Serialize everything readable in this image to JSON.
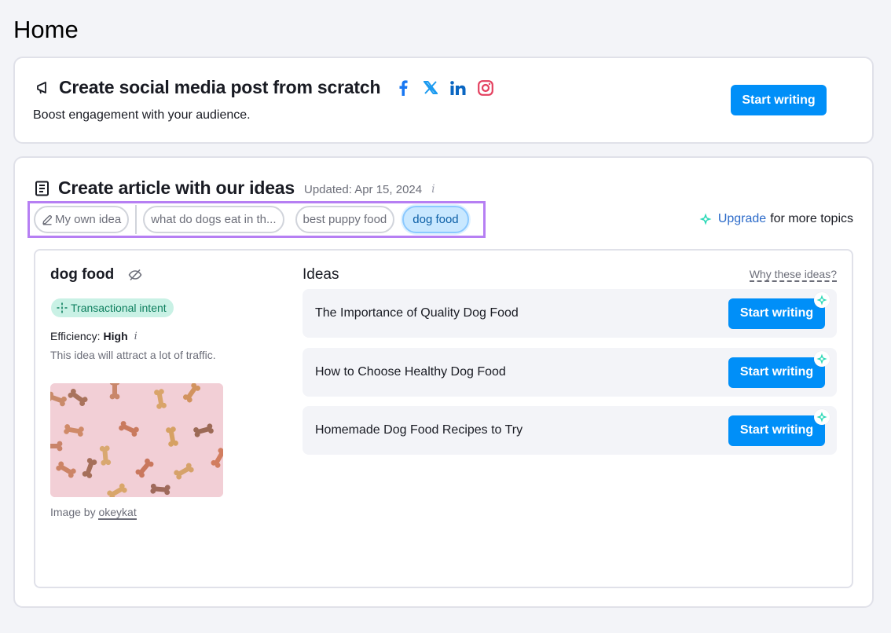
{
  "page": {
    "title": "Home"
  },
  "social_card": {
    "title": "Create social media post from scratch",
    "subtitle": "Boost engagement with your audience.",
    "networks": [
      {
        "name": "Facebook",
        "icon": "facebook-icon",
        "color": "#1877f2"
      },
      {
        "name": "X",
        "icon": "x-icon",
        "color": "#1d9bf0"
      },
      {
        "name": "LinkedIn",
        "icon": "linkedin-icon",
        "color": "#0a66c2"
      },
      {
        "name": "Instagram",
        "icon": "instagram-icon",
        "color": "#e4405f"
      }
    ],
    "start_button": "Start writing"
  },
  "article_card": {
    "title": "Create article with our ideas",
    "updated": "Updated: Apr 15, 2024",
    "topics": [
      {
        "label": "My own idea",
        "icon": "pencil-icon",
        "active": false
      },
      {
        "label": "what do dogs eat in th...",
        "active": false
      },
      {
        "label": "best puppy food",
        "active": false
      },
      {
        "label": "dog food",
        "active": true
      }
    ],
    "upgrade": {
      "link": "Upgrade",
      "text": "for more topics"
    },
    "topic_detail": {
      "title": "dog food",
      "intent": "Transactional intent",
      "efficiency_label": "Efficiency:",
      "efficiency_value": "High",
      "efficiency_desc": "This idea will attract a lot of traffic.",
      "image_credit_prefix": "Image by",
      "image_credit_author": "okeykat"
    },
    "ideas": {
      "header": "Ideas",
      "why_link": "Why these ideas?",
      "items": [
        {
          "title": "The Importance of Quality Dog Food",
          "button": "Start writing"
        },
        {
          "title": "How to Choose Healthy Dog Food",
          "button": "Start writing"
        },
        {
          "title": "Homemade Dog Food Recipes to Try",
          "button": "Start writing"
        }
      ]
    }
  },
  "colors": {
    "primary": "#008ff8",
    "highlight_border": "#b67ff3",
    "intent_bg": "#c9f1e5",
    "ai_sparkle": "#2fd9b8"
  }
}
